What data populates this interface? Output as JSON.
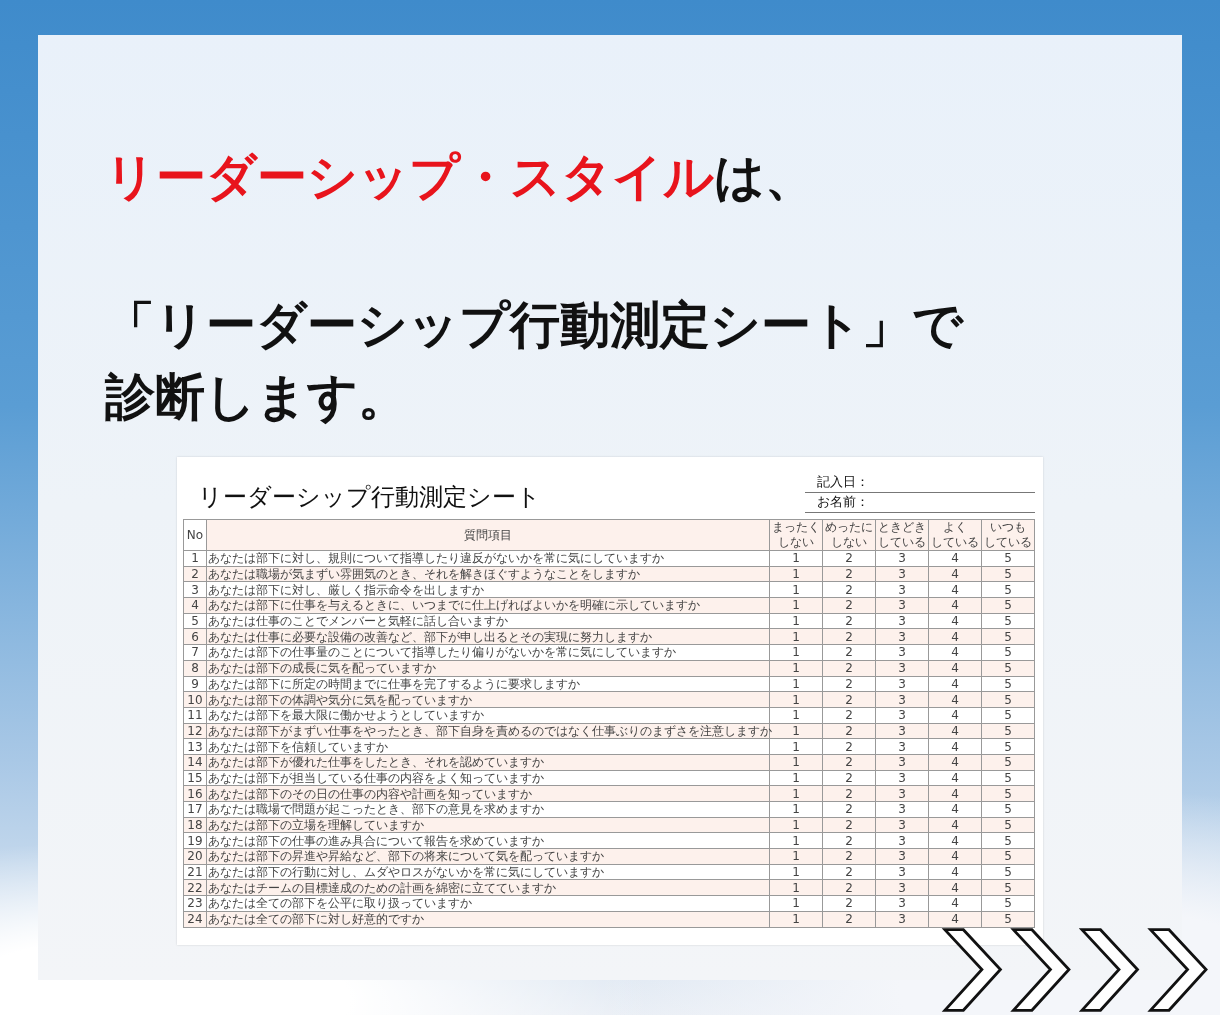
{
  "headline": {
    "segments": [
      {
        "text": "リーダーシップ・スタイル",
        "emphasis": true
      },
      {
        "text": "は、",
        "emphasis": false
      }
    ]
  },
  "lead": {
    "lines": [
      "「リーダーシップ行動測定シート」で",
      "診断します。"
    ]
  },
  "sheet": {
    "title": "リーダーシップ行動測定シート",
    "fields": [
      {
        "label": "記入日："
      },
      {
        "label": "お名前："
      }
    ],
    "columns": [
      {
        "lines": [
          "No"
        ]
      },
      {
        "lines": [
          "質問項目"
        ]
      },
      {
        "lines": [
          "まったく",
          "しない"
        ]
      },
      {
        "lines": [
          "めったに",
          "しない"
        ]
      },
      {
        "lines": [
          "ときどき",
          "している"
        ]
      },
      {
        "lines": [
          "よく",
          "している"
        ]
      },
      {
        "lines": [
          "いつも",
          "している"
        ]
      }
    ],
    "rows": [
      {
        "no": "1",
        "question": "あなたは部下に対し、規則について指導したり違反がないかを常に気にしていますか",
        "scores": [
          "1",
          "2",
          "3",
          "4",
          "5"
        ]
      },
      {
        "no": "2",
        "question": "あなたは職場が気まずい雰囲気のとき、それを解きほぐすようなことをしますか",
        "scores": [
          "1",
          "2",
          "3",
          "4",
          "5"
        ]
      },
      {
        "no": "3",
        "question": "あなたは部下に対し、厳しく指示命令を出しますか",
        "scores": [
          "1",
          "2",
          "3",
          "4",
          "5"
        ]
      },
      {
        "no": "4",
        "question": "あなたは部下に仕事を与えるときに、いつまでに仕上げればよいかを明確に示していますか",
        "scores": [
          "1",
          "2",
          "3",
          "4",
          "5"
        ]
      },
      {
        "no": "5",
        "question": "あなたは仕事のことでメンバーと気軽に話し合いますか",
        "scores": [
          "1",
          "2",
          "3",
          "4",
          "5"
        ]
      },
      {
        "no": "6",
        "question": "あなたは仕事に必要な設備の改善など、部下が申し出るとその実現に努力しますか",
        "scores": [
          "1",
          "2",
          "3",
          "4",
          "5"
        ]
      },
      {
        "no": "7",
        "question": "あなたは部下の仕事量のことについて指導したり偏りがないかを常に気にしていますか",
        "scores": [
          "1",
          "2",
          "3",
          "4",
          "5"
        ]
      },
      {
        "no": "8",
        "question": "あなたは部下の成長に気を配っていますか",
        "scores": [
          "1",
          "2",
          "3",
          "4",
          "5"
        ]
      },
      {
        "no": "9",
        "question": "あなたは部下に所定の時間までに仕事を完了するように要求しますか",
        "scores": [
          "1",
          "2",
          "3",
          "4",
          "5"
        ]
      },
      {
        "no": "10",
        "question": "あなたは部下の体調や気分に気を配っていますか",
        "scores": [
          "1",
          "2",
          "3",
          "4",
          "5"
        ]
      },
      {
        "no": "11",
        "question": "あなたは部下を最大限に働かせようとしていますか",
        "scores": [
          "1",
          "2",
          "3",
          "4",
          "5"
        ]
      },
      {
        "no": "12",
        "question": "あなたは部下がまずい仕事をやったとき、部下自身を責めるのではなく仕事ぶりのまずさを注意しますか",
        "scores": [
          "1",
          "2",
          "3",
          "4",
          "5"
        ]
      },
      {
        "no": "13",
        "question": "あなたは部下を信頼していますか",
        "scores": [
          "1",
          "2",
          "3",
          "4",
          "5"
        ]
      },
      {
        "no": "14",
        "question": "あなたは部下が優れた仕事をしたとき、それを認めていますか",
        "scores": [
          "1",
          "2",
          "3",
          "4",
          "5"
        ]
      },
      {
        "no": "15",
        "question": "あなたは部下が担当している仕事の内容をよく知っていますか",
        "scores": [
          "1",
          "2",
          "3",
          "4",
          "5"
        ]
      },
      {
        "no": "16",
        "question": "あなたは部下のその日の仕事の内容や計画を知っていますか",
        "scores": [
          "1",
          "2",
          "3",
          "4",
          "5"
        ]
      },
      {
        "no": "17",
        "question": "あなたは職場で問題が起こったとき、部下の意見を求めますか",
        "scores": [
          "1",
          "2",
          "3",
          "4",
          "5"
        ]
      },
      {
        "no": "18",
        "question": "あなたは部下の立場を理解していますか",
        "scores": [
          "1",
          "2",
          "3",
          "4",
          "5"
        ]
      },
      {
        "no": "19",
        "question": "あなたは部下の仕事の進み具合について報告を求めていますか",
        "scores": [
          "1",
          "2",
          "3",
          "4",
          "5"
        ]
      },
      {
        "no": "20",
        "question": "あなたは部下の昇進や昇給など、部下の将来について気を配っていますか",
        "scores": [
          "1",
          "2",
          "3",
          "4",
          "5"
        ]
      },
      {
        "no": "21",
        "question": "あなたは部下の行動に対し、ムダやロスがないかを常に気にしていますか",
        "scores": [
          "1",
          "2",
          "3",
          "4",
          "5"
        ]
      },
      {
        "no": "22",
        "question": "あなたはチームの目標達成のための計画を綿密に立てていますか",
        "scores": [
          "1",
          "2",
          "3",
          "4",
          "5"
        ]
      },
      {
        "no": "23",
        "question": "あなたは全ての部下を公平に取り扱っていますか",
        "scores": [
          "1",
          "2",
          "3",
          "4",
          "5"
        ]
      },
      {
        "no": "24",
        "question": "あなたは全ての部下に対し好意的ですか",
        "scores": [
          "1",
          "2",
          "3",
          "4",
          "5"
        ]
      }
    ]
  }
}
